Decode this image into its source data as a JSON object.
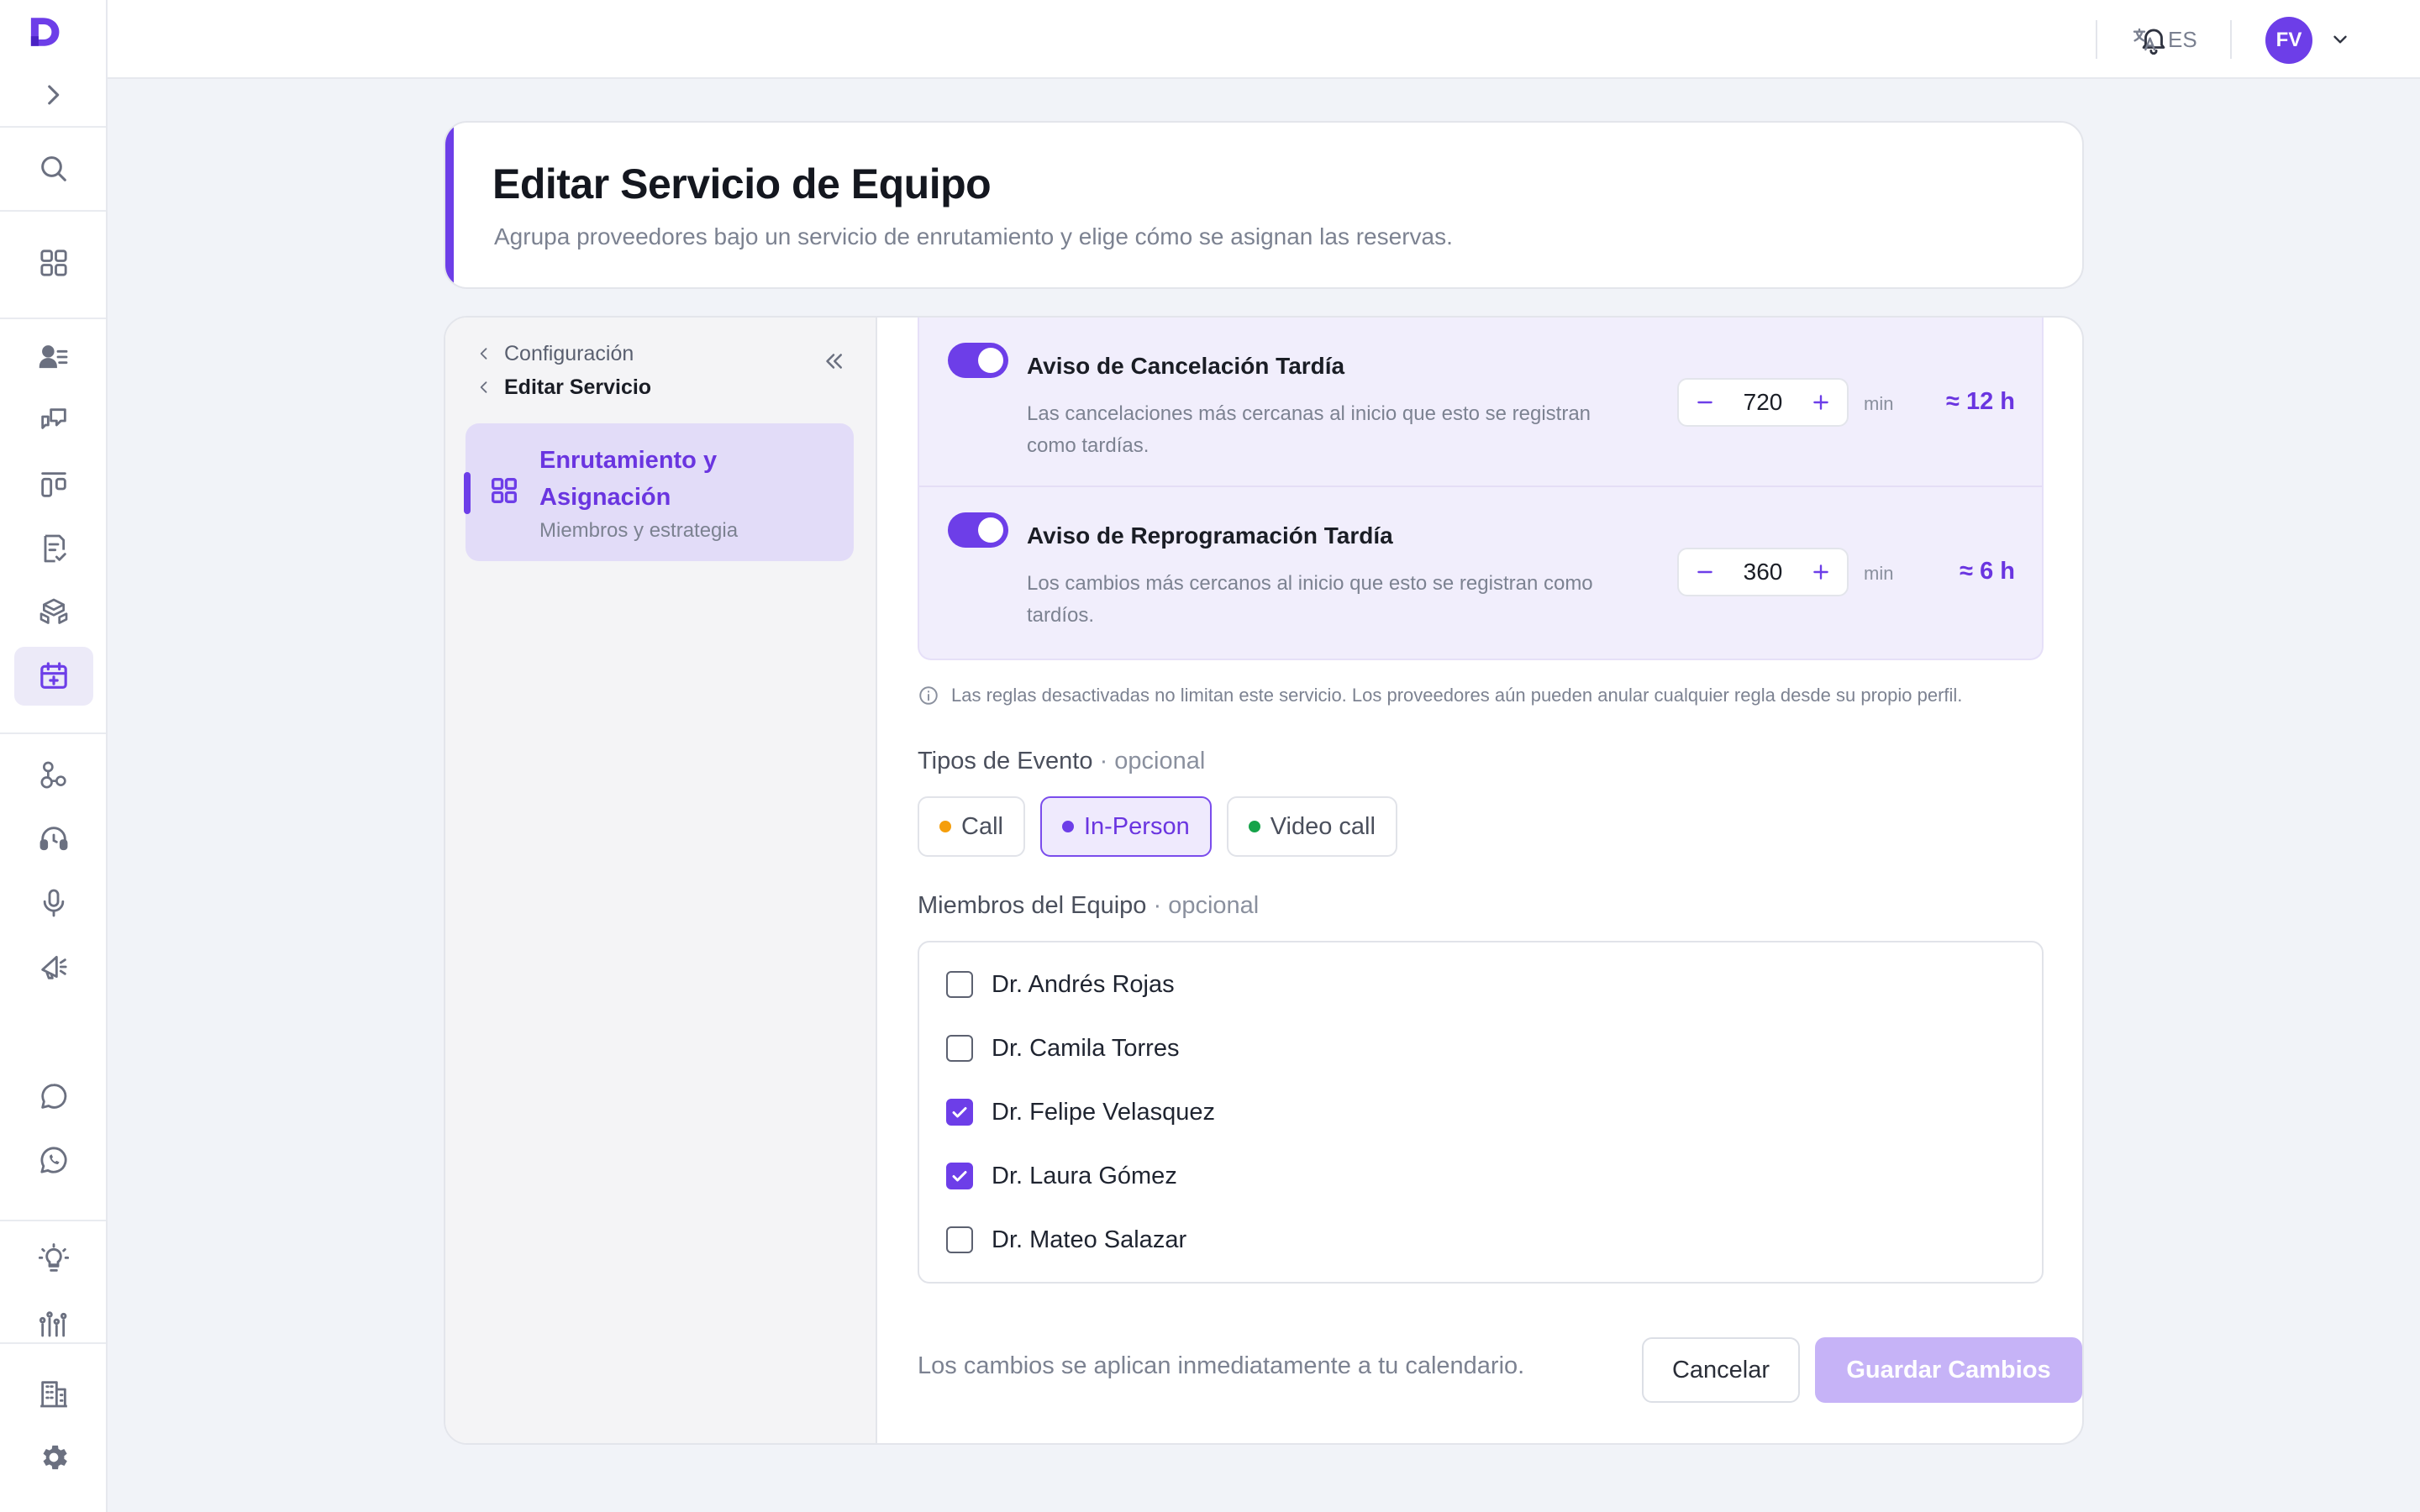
{
  "topbar": {
    "language": "ES",
    "avatar_initials": "FV"
  },
  "header": {
    "title": "Editar Servicio de Equipo",
    "subtitle": "Agrupa proveedores bajo un servicio de enrutamiento y elige cómo se asignan las reservas."
  },
  "subnav": {
    "breadcrumbs": [
      "Configuración",
      "Editar Servicio"
    ],
    "active_item": {
      "title": "Enrutamiento y Asignación",
      "subtitle": "Miembros y estrategia"
    }
  },
  "rules": [
    {
      "enabled": true,
      "title": "Aviso de Cancelación Tardía",
      "description": "Las cancelaciones más cercanas al inicio que esto se registran como tardías.",
      "value": "720",
      "unit": "min",
      "approx": "≈ 12 h"
    },
    {
      "enabled": true,
      "title": "Aviso de Reprogramación Tardía",
      "description": "Los cambios más cercanos al inicio que esto se registran como tardíos.",
      "value": "360",
      "unit": "min",
      "approx": "≈ 6 h"
    }
  ],
  "rules_note": "Las reglas desactivadas no limitan este servicio. Los proveedores aún pueden anular cualquier regla desde su propio perfil.",
  "event_types": {
    "label": "Tipos de Evento",
    "optional": "· opcional",
    "options": [
      {
        "label": "Call",
        "color": "#f59e0b",
        "selected": false
      },
      {
        "label": "In-Person",
        "color": "#6d3ee8",
        "selected": true
      },
      {
        "label": "Video call",
        "color": "#16a34a",
        "selected": false
      }
    ]
  },
  "team_members": {
    "label": "Miembros del Equipo",
    "optional": "· opcional",
    "members": [
      {
        "name": "Dr. Andrés Rojas",
        "checked": false
      },
      {
        "name": "Dr. Camila Torres",
        "checked": false
      },
      {
        "name": "Dr. Felipe Velasquez",
        "checked": true
      },
      {
        "name": "Dr. Laura Gómez",
        "checked": true
      },
      {
        "name": "Dr. Mateo Salazar",
        "checked": false
      }
    ]
  },
  "footer": {
    "note": "Los cambios se aplican inmediatamente a tu calendario.",
    "cancel_label": "Cancelar",
    "save_label": "Guardar Cambios"
  },
  "colors": {
    "accent": "#6d3ee8",
    "accent_soft": "#e2dcf8",
    "save_disabled": "#c6b3f7"
  }
}
